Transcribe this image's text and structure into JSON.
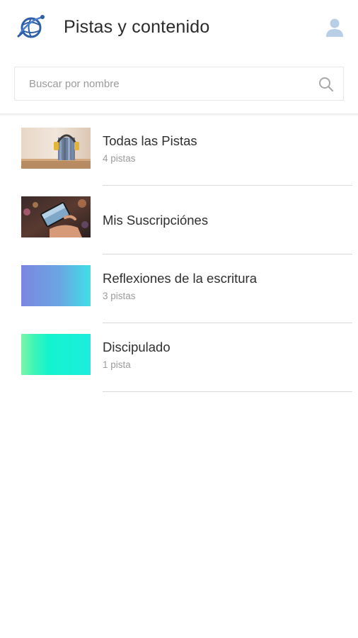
{
  "header": {
    "title": "Pistas y contenido",
    "logo_icon": "globe-logo-icon",
    "user_icon": "user-icon"
  },
  "search": {
    "placeholder": "Buscar por nombre",
    "value": "",
    "icon": "search-icon"
  },
  "colors": {
    "accent": "#2f5fa8",
    "user_icon": "#b8cde6",
    "divider": "#d9d9d9",
    "gradient_reflexiones": [
      "#7c86e0",
      "#3fe0e6"
    ],
    "gradient_discipulado": [
      "#5ef0b8",
      "#14f3cf"
    ]
  },
  "items": [
    {
      "title": "Todas las Pistas",
      "subtitle": "4 pistas",
      "thumbnail": "books-headphones-photo"
    },
    {
      "title": "Mis Suscripciónes",
      "subtitle": "",
      "thumbnail": "phone-in-hand-photo"
    },
    {
      "title": "Reflexiones de la escritura",
      "subtitle": "3 pistas",
      "thumbnail": "purple-cyan-gradient"
    },
    {
      "title": "Discipulado",
      "subtitle": "1 pista",
      "thumbnail": "green-cyan-gradient"
    }
  ]
}
